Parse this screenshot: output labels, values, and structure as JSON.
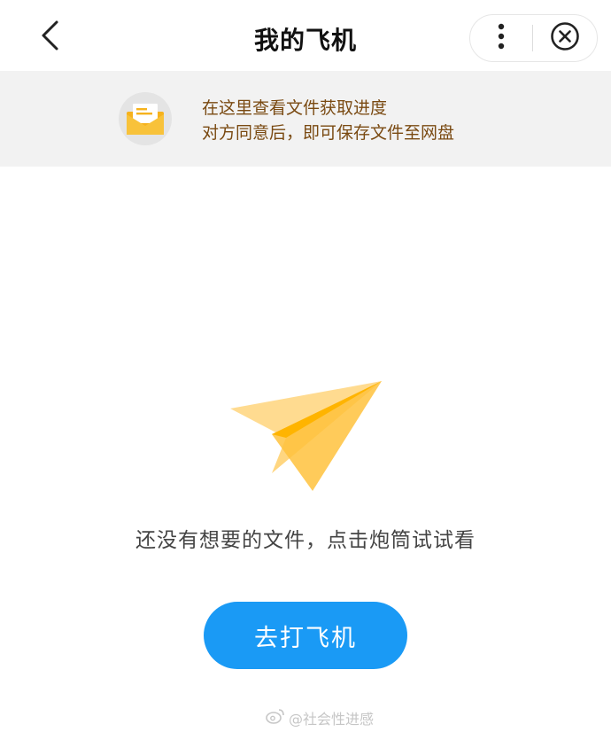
{
  "header": {
    "title": "我的飞机",
    "back_icon": "chevron-left-icon",
    "more_icon": "more-vertical-icon",
    "close_icon": "close-circle-icon"
  },
  "banner": {
    "icon": "mail-icon",
    "line1": "在这里查看文件获取进度",
    "line2": "对方同意后，即可保存文件至网盘",
    "text_color": "#7a4a12",
    "background": "#f2f2f2"
  },
  "empty_state": {
    "illustration": "paper-plane-icon",
    "message": "还没有想要的文件，点击炮筒试试看",
    "button_label": "去打飞机"
  },
  "watermark": {
    "text": "@社会性进感",
    "icon": "weibo-icon"
  },
  "colors": {
    "accent": "#1a9af5",
    "plane": "#ffb400"
  }
}
